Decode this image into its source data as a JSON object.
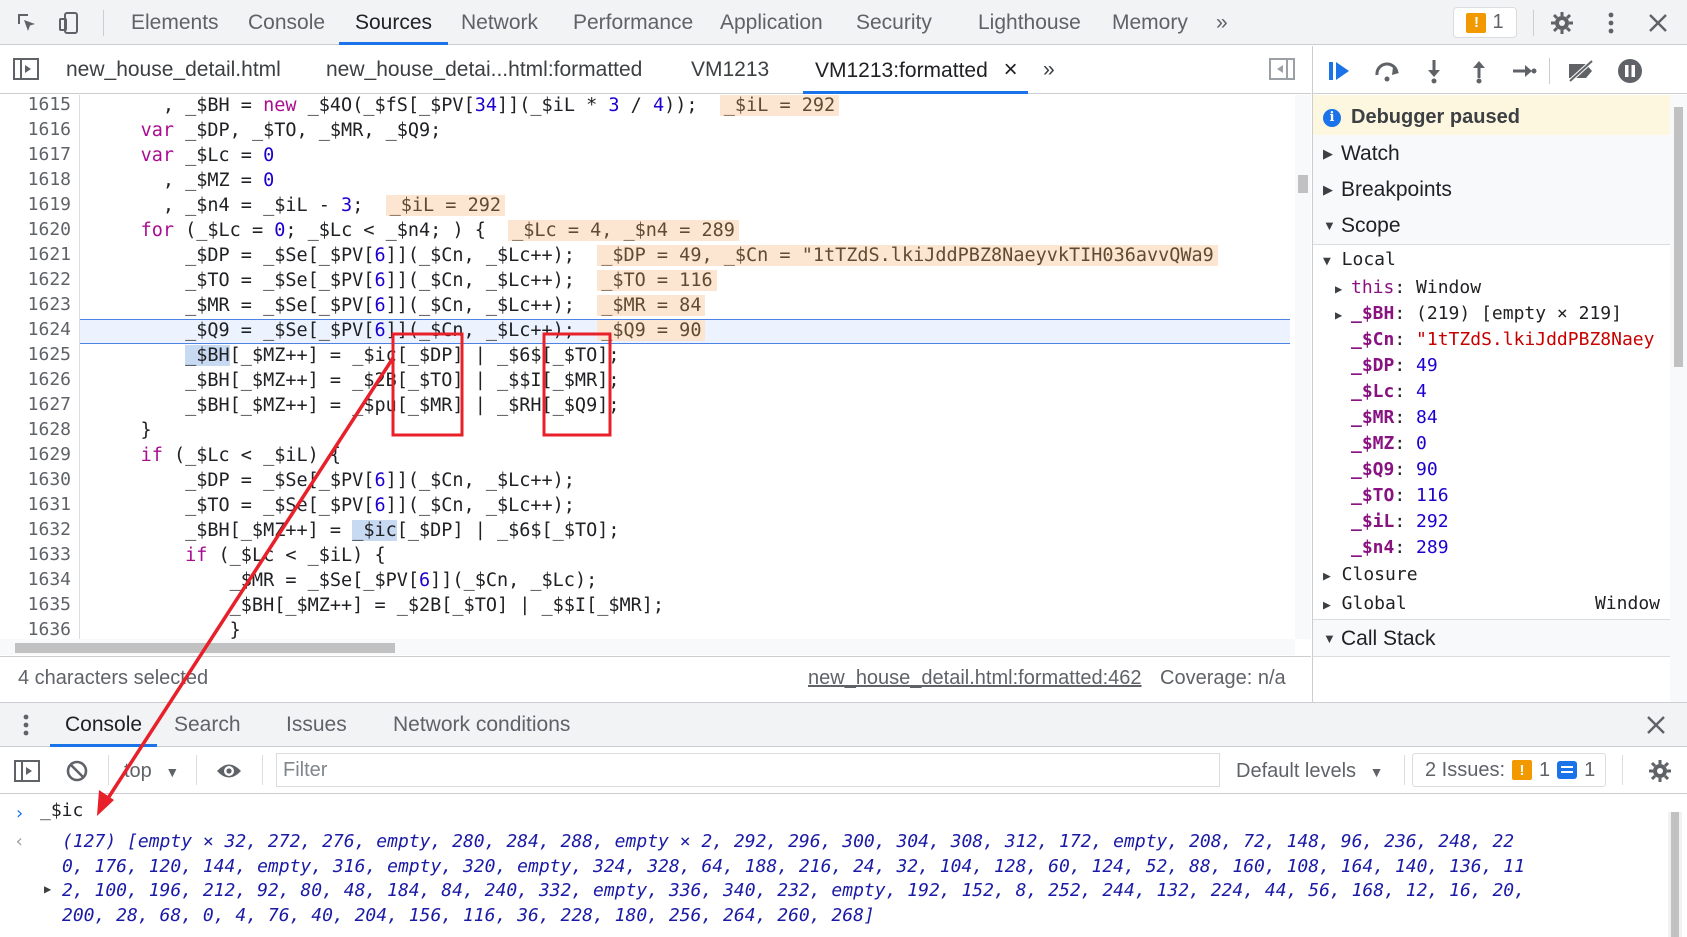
{
  "main_tabs": [
    "Elements",
    "Console",
    "Sources",
    "Network",
    "Performance",
    "Application",
    "Security",
    "Lighthouse",
    "Memory"
  ],
  "more_tabs_glyph": "»",
  "issues_count": "1",
  "file_tabs": [
    "new_house_detail.html",
    "new_house_detai...html:formatted",
    "VM1213",
    "VM1213:formatted"
  ],
  "file_tab_close": "×",
  "line_numbers": [
    "1615",
    "1616",
    "1617",
    "1618",
    "1619",
    "1620",
    "1621",
    "1622",
    "1623",
    "1624",
    "1625",
    "1626",
    "1627",
    "1628",
    "1629",
    "1630",
    "1631",
    "1632",
    "1633",
    "1634",
    "1635",
    "1636"
  ],
  "inline_values": {
    "l1615": "_$iL = 292",
    "l1619": "_$iL = 292",
    "l1620": "_$Lc = 4, _$n4 = 289",
    "l1621": "_$DP = 49, _$Cn = \"1tTZdS.lkiJddPBZ8NaeyvkTIH036avvQWa9",
    "l1622": "_$TO = 116",
    "l1623": "_$MR = 84",
    "l1624": "_$Q9 = 90"
  },
  "status": {
    "selection": "4 characters selected",
    "location": "new_house_detail.html:formatted:462",
    "coverage": "Coverage: n/a"
  },
  "debugger": {
    "paused_label": "Debugger paused",
    "sections": [
      "Watch",
      "Breakpoints",
      "Scope",
      "Call Stack"
    ],
    "local_label": "Local",
    "closure_label": "Closure",
    "global_label": "Global",
    "global_value": "Window",
    "scope_vars": [
      {
        "name": "this",
        "value": "Window",
        "kind": "plain",
        "expandable": true
      },
      {
        "name": "_$BH",
        "value": "(219) [empty × 219]",
        "kind": "plain",
        "expandable": true
      },
      {
        "name": "_$Cn",
        "value": "\"1tTZdS.lkiJddPBZ8Naey",
        "kind": "string",
        "expandable": false
      },
      {
        "name": "_$DP",
        "value": "49",
        "kind": "number",
        "expandable": false
      },
      {
        "name": "_$Lc",
        "value": "4",
        "kind": "number",
        "expandable": false
      },
      {
        "name": "_$MR",
        "value": "84",
        "kind": "number",
        "expandable": false
      },
      {
        "name": "_$MZ",
        "value": "0",
        "kind": "number",
        "expandable": false
      },
      {
        "name": "_$Q9",
        "value": "90",
        "kind": "number",
        "expandable": false
      },
      {
        "name": "_$TO",
        "value": "116",
        "kind": "number",
        "expandable": false
      },
      {
        "name": "_$iL",
        "value": "292",
        "kind": "number",
        "expandable": false
      },
      {
        "name": "_$n4",
        "value": "289",
        "kind": "number",
        "expandable": false
      }
    ]
  },
  "drawer": {
    "tabs": [
      "Console",
      "Search",
      "Issues",
      "Network conditions"
    ],
    "context": "top",
    "filter_placeholder": "Filter",
    "levels": "Default levels",
    "issues_label": "2 Issues:",
    "issues_warn": "1",
    "issues_info": "1"
  },
  "console": {
    "input": "_$ic",
    "output_lines": [
      "(127) [empty × 32, 272, 276, empty, 280, 284, 288, empty × 2, 292, 296, 300, 304, 308, 312, 172, empty, 208, 72, 148, 96, 236, 248, 22",
      "0, 176, 120, 144, empty, 316, empty, 320, empty, 324, 328, 64, 188, 216, 24, 32, 104, 128, 60, 124, 52, 88, 160, 108, 164, 140, 136, 11",
      "2, 100, 196, 212, 92, 80, 48, 184, 84, 240, 332, empty, 336, 340, 232, empty, 192, 152, 8, 252, 244, 132, 224, 44, 56, 168, 12, 16, 20,",
      "200, 28, 68, 0, 4, 76, 40, 204, 156, 116, 36, 228, 180, 256, 264, 260, 268]"
    ]
  },
  "colors": {
    "accent": "#1a73e8",
    "annotation": "#e8202a",
    "inline_value_bg": "#fce6d2",
    "paused_bg": "#fef7e0"
  }
}
